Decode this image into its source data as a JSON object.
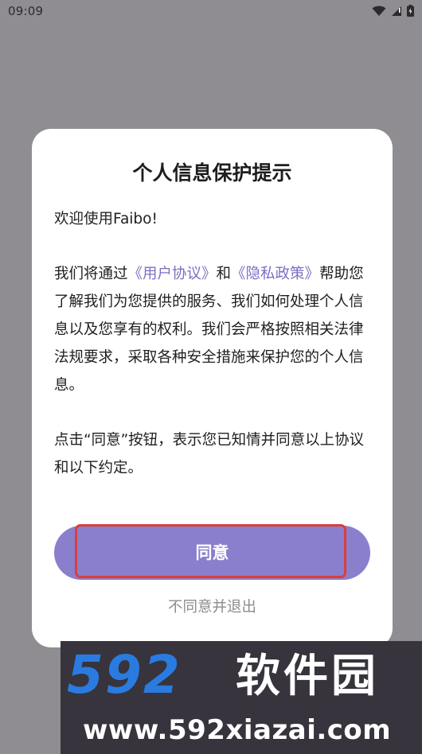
{
  "status_bar": {
    "time": "09:09"
  },
  "dialog": {
    "title": "个人信息保护提示",
    "welcome": "欢迎使用Faibo!",
    "para1_prefix": "我们将通过",
    "user_agreement_link": "《用户协议》",
    "and": "和",
    "privacy_policy_link": "《隐私政策》",
    "para1_suffix": "帮助您了解我们为您提供的服务、我们如何处理个人信息以及您享有的权利。我们会严格按照相关法律法规要求，采取各种安全措施来保护您的个人信息。",
    "para2": "点击“同意”按钮，表示您已知情并同意以上协议和以下约定。",
    "agree_label": "同意",
    "disagree_label": "不同意并退出"
  },
  "watermark": {
    "logo_number": "592",
    "name": "软件园",
    "url": "www.592xiazai.com"
  },
  "colors": {
    "link": "#7b70c4",
    "agree_button": "#8a7fcd",
    "highlight": "#d9403b",
    "overlay": "#8f8d92"
  }
}
